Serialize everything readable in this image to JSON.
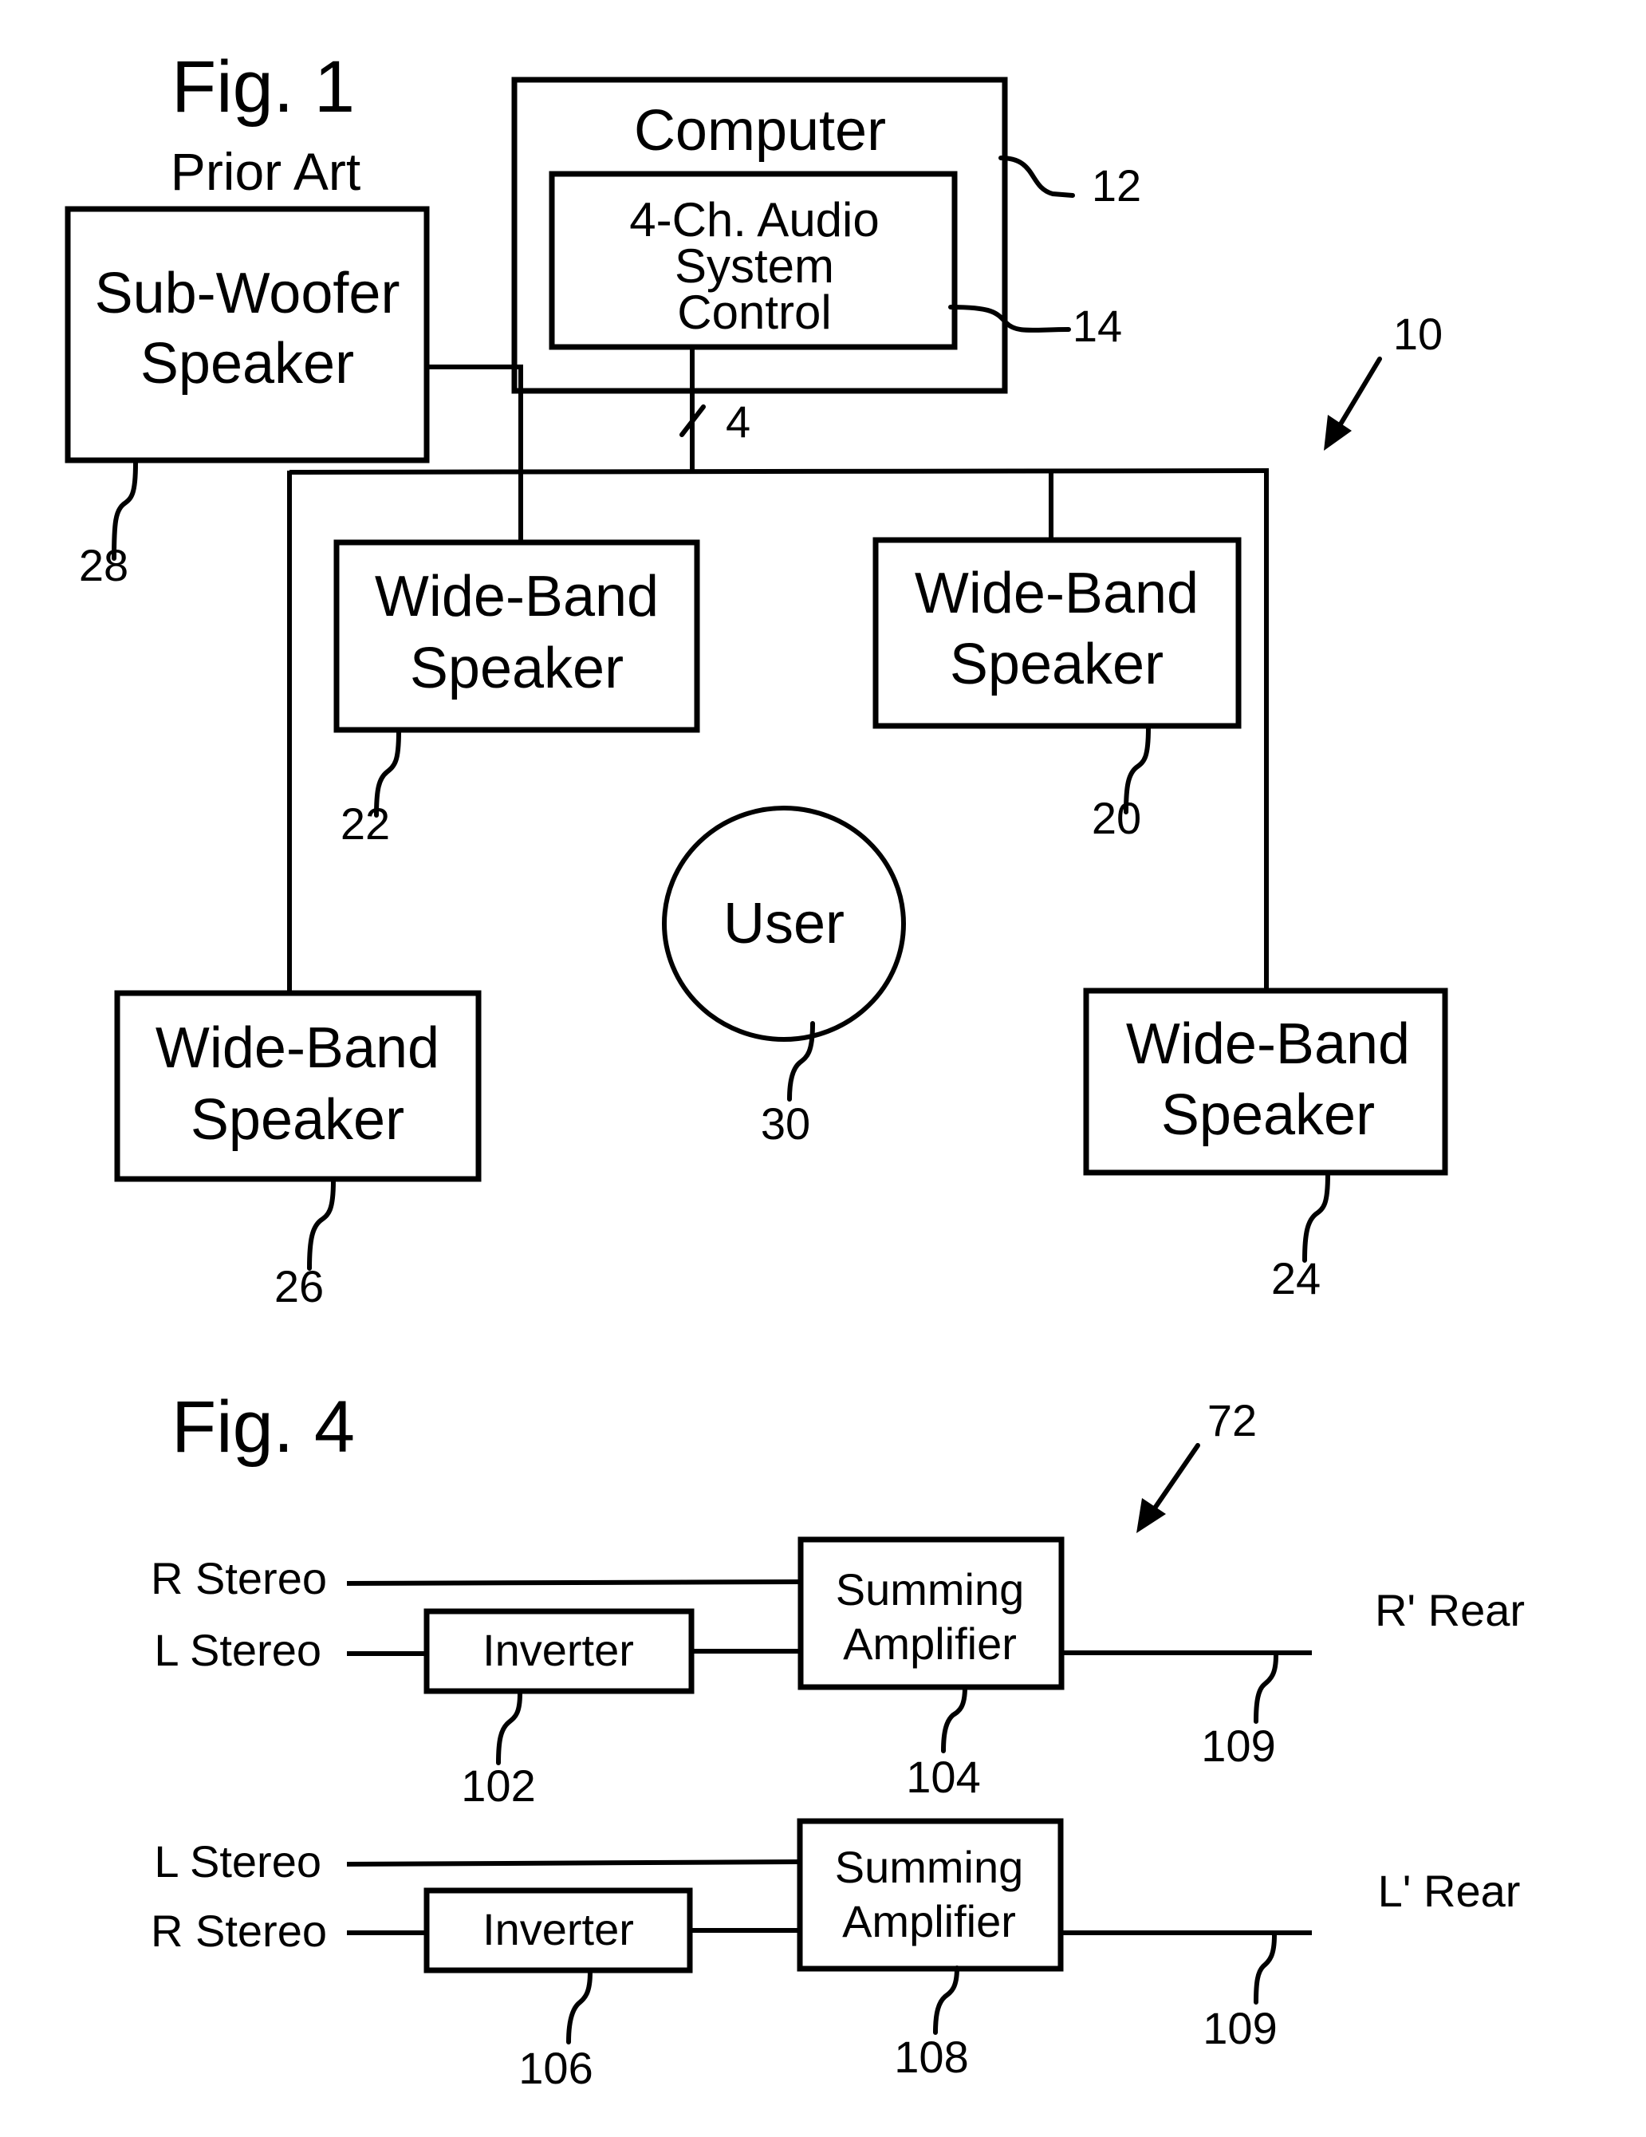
{
  "fig1": {
    "title": "Fig. 1",
    "subtitle": "Prior Art",
    "system_ref": "10",
    "computer": {
      "label": "Computer",
      "ref": "12"
    },
    "audio_control": {
      "lines": [
        "4-Ch. Audio",
        "System",
        "Control"
      ],
      "ref": "14"
    },
    "bus_label": "4",
    "subwoofer": {
      "lines": [
        "Sub-Woofer",
        "Speaker"
      ],
      "ref": "28"
    },
    "speakers": [
      {
        "lines": [
          "Wide-Band",
          "Speaker"
        ],
        "ref": "22",
        "position": "front-left"
      },
      {
        "lines": [
          "Wide-Band",
          "Speaker"
        ],
        "ref": "20",
        "position": "front-right"
      },
      {
        "lines": [
          "Wide-Band",
          "Speaker"
        ],
        "ref": "26",
        "position": "rear-left"
      },
      {
        "lines": [
          "Wide-Band",
          "Speaker"
        ],
        "ref": "24",
        "position": "rear-right"
      }
    ],
    "user": {
      "label": "User",
      "ref": "30"
    }
  },
  "fig4": {
    "title": "Fig. 4",
    "circuit_ref": "72",
    "channels": [
      {
        "direct_input": "R Stereo",
        "inverted_input": "L Stereo",
        "inverter": {
          "label": "Inverter",
          "ref": "102"
        },
        "amplifier": {
          "lines": [
            "Summing",
            "Amplifier"
          ],
          "ref": "104"
        },
        "output_ref": "109",
        "output": "R' Rear"
      },
      {
        "direct_input": "L Stereo",
        "inverted_input": "R Stereo",
        "inverter": {
          "label": "Inverter",
          "ref": "106"
        },
        "amplifier": {
          "lines": [
            "Summing",
            "Amplifier"
          ],
          "ref": "108"
        },
        "output_ref": "109",
        "output": "L' Rear"
      }
    ]
  }
}
